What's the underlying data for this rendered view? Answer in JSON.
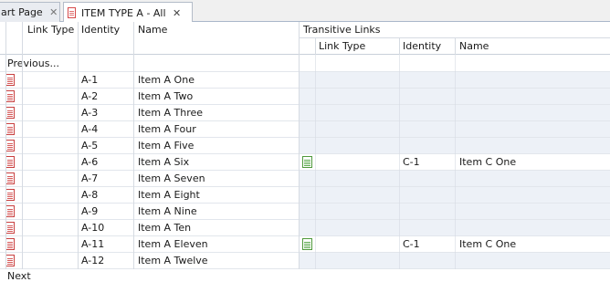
{
  "tabs": [
    {
      "label": "art Page"
    },
    {
      "label": "ITEM TYPE A - All"
    }
  ],
  "columns": {
    "link_type": "Link Type",
    "identity": "Identity",
    "name": "Name",
    "transitive_group": "Transitive Links",
    "t_link_type": "Link Type",
    "t_identity": "Identity",
    "t_name": "Name"
  },
  "previous_label": "Previous...",
  "next_label": "Next",
  "rows": [
    {
      "identity": "A-1",
      "name": "Item A One",
      "t_identity": "",
      "t_name": ""
    },
    {
      "identity": "A-2",
      "name": "Item A Two",
      "t_identity": "",
      "t_name": ""
    },
    {
      "identity": "A-3",
      "name": "Item A Three",
      "t_identity": "",
      "t_name": ""
    },
    {
      "identity": "A-4",
      "name": "Item A Four",
      "t_identity": "",
      "t_name": ""
    },
    {
      "identity": "A-5",
      "name": "Item A Five",
      "t_identity": "",
      "t_name": ""
    },
    {
      "identity": "A-6",
      "name": "Item A Six",
      "t_identity": "C-1",
      "t_name": "Item C One"
    },
    {
      "identity": "A-7",
      "name": "Item A Seven",
      "t_identity": "",
      "t_name": ""
    },
    {
      "identity": "A-8",
      "name": "Item A Eight",
      "t_identity": "",
      "t_name": ""
    },
    {
      "identity": "A-9",
      "name": "Item A Nine",
      "t_identity": "",
      "t_name": ""
    },
    {
      "identity": "A-10",
      "name": "Item A Ten",
      "t_identity": "",
      "t_name": ""
    },
    {
      "identity": "A-11",
      "name": "Item A Eleven",
      "t_identity": "C-1",
      "t_name": "Item C One"
    },
    {
      "identity": "A-12",
      "name": "Item A Twelve",
      "t_identity": "",
      "t_name": ""
    }
  ]
}
